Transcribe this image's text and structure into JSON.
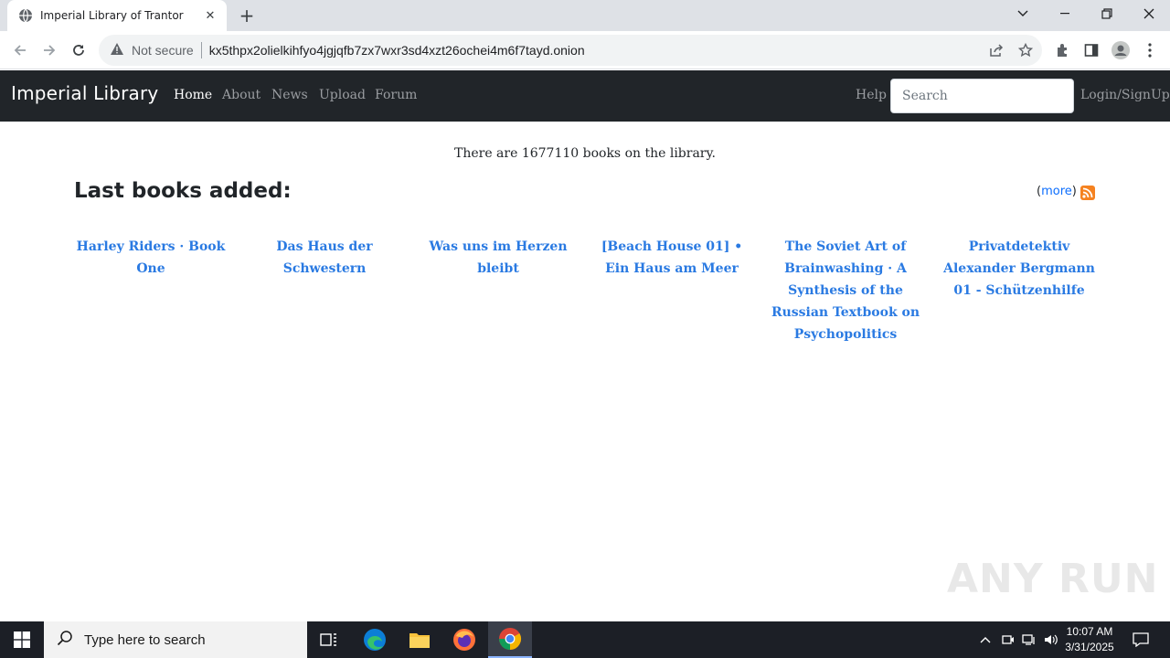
{
  "browser": {
    "tab_title": "Imperial Library of Trantor",
    "security_label": "Not secure",
    "url": "kx5thpx2olielkihfyo4jgjqfb7zx7wxr3sd4xzt26ochei4m6f7tayd.onion"
  },
  "site": {
    "brand": "Imperial Library",
    "nav": [
      "Home",
      "About",
      "News",
      "Upload",
      "Forum"
    ],
    "help": "Help",
    "search_placeholder": "Search",
    "login": "Login/SignUp"
  },
  "main": {
    "count_text": "There are 1677110 books on the library.",
    "section_title": "Last books added:",
    "more_open": "(",
    "more_label": "more",
    "more_close": ")",
    "books": [
      "Harley Riders · Book One",
      "Das Haus der Schwestern",
      "Was uns im Herzen bleibt",
      "[Beach House 01] • Ein Haus am Meer",
      "The Soviet Art of Brainwashing · A Synthesis of the Russian Textbook on Psychopolitics",
      "Privatdetektiv Alexander Bergmann 01 - Schützenhilfe"
    ]
  },
  "watermark": "ANY RUN",
  "taskbar": {
    "search_placeholder": "Type here to search",
    "time": "10:07 AM",
    "date": "3/31/2025"
  },
  "colors": {
    "navbar_bg": "#212529",
    "link_blue": "#2a7ae2",
    "rss_orange": "#f58220"
  }
}
